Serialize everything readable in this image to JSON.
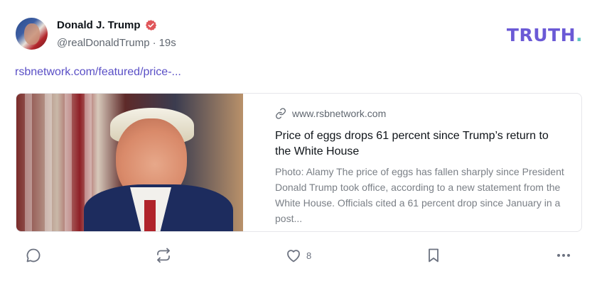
{
  "post": {
    "author_name": "Donald J. Trump",
    "handle": "@realDonaldTrump",
    "separator": "·",
    "time": "19s",
    "link_text": "rsbnetwork.com/featured/price-..."
  },
  "brand": {
    "logo_text": "TRUTH",
    "logo_dot": ".",
    "accent": "#6b5ad6",
    "dot_color": "#5ec6c2",
    "verified_color": "#e0565a"
  },
  "card": {
    "domain": "www.rsbnetwork.com",
    "title": "Price of eggs drops 61 percent since Trump’s return to the White House",
    "description": "Photo: Alamy The price of eggs has fallen sharply since President Donald Trump took office, according to a new statement from the White House. Officials cited a 61 percent drop since January in a post..."
  },
  "actions": {
    "reply_icon": "comment-icon",
    "retruth_icon": "repost-icon",
    "like_icon": "heart-icon",
    "like_count": "8",
    "bookmark_icon": "bookmark-icon",
    "more_icon": "more-icon"
  }
}
